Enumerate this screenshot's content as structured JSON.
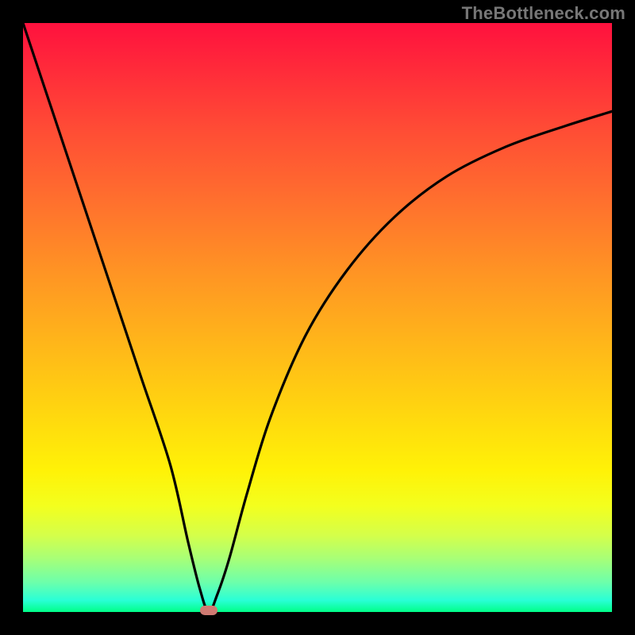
{
  "watermark": "TheBottleneck.com",
  "chart_data": {
    "type": "line",
    "title": "",
    "xlabel": "",
    "ylabel": "",
    "xlim": [
      0,
      100
    ],
    "ylim": [
      0,
      100
    ],
    "grid": false,
    "legend": false,
    "series": [
      {
        "name": "curve",
        "x": [
          0,
          5,
          10,
          15,
          20,
          25,
          28,
          30,
          31.5,
          33,
          35,
          38,
          42,
          48,
          55,
          63,
          72,
          82,
          92,
          100
        ],
        "values": [
          100,
          85,
          70,
          55,
          40,
          25,
          12,
          4,
          0,
          3,
          9,
          20,
          33,
          47,
          58,
          67,
          74,
          79,
          82.5,
          85
        ]
      }
    ],
    "marker": {
      "x": 31.5,
      "y": 0
    }
  },
  "colors": {
    "frame": "#000000",
    "curve": "#000000",
    "marker": "#cf7a72"
  }
}
